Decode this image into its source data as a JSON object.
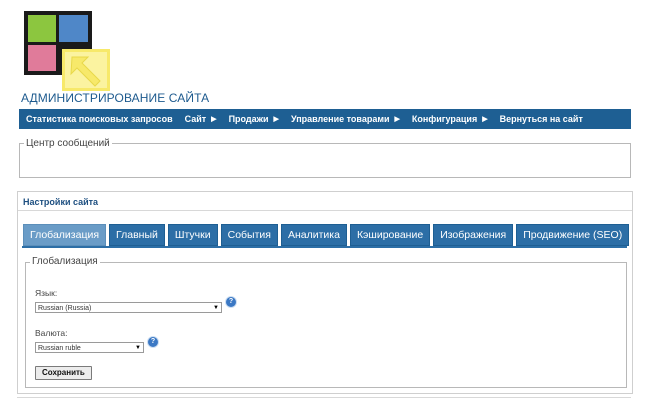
{
  "header": {
    "site_title": "АДМИНИСТРИРОВАНИЕ САЙТА",
    "logo_colors": {
      "green": "#8cc63f",
      "blue": "#4f87c8",
      "pink": "#e07b9a",
      "yellow": "#f7e96a",
      "frame": "#1a1a1a"
    }
  },
  "nav": {
    "items": [
      {
        "label": "Статистика поисковых запросов",
        "arrow": ""
      },
      {
        "label": "Сайт",
        "arrow": "▶"
      },
      {
        "label": "Продажи",
        "arrow": "▶"
      },
      {
        "label": "Управление товарами",
        "arrow": "▶"
      },
      {
        "label": "Конфигурация",
        "arrow": "▶"
      },
      {
        "label": "Вернуться на сайт",
        "arrow": ""
      }
    ]
  },
  "messages": {
    "legend": "Центр сообщений"
  },
  "settings": {
    "title": "Настройки сайта",
    "tabs": [
      {
        "label": "Глобализация"
      },
      {
        "label": "Главный"
      },
      {
        "label": "Штучки"
      },
      {
        "label": "События"
      },
      {
        "label": "Аналитика"
      },
      {
        "label": "Кэширование"
      },
      {
        "label": "Изображения"
      },
      {
        "label": "Продвижение (SEO)"
      }
    ],
    "active_tab": "Глобализация",
    "fieldset_legend": "Глобализация",
    "language_label": "Язык:",
    "language_value": "Russian (Russia)",
    "currency_label": "Валюта:",
    "currency_value": "Russian ruble",
    "help_glyph": "?",
    "save_label": "Сохранить"
  },
  "colors": {
    "nav_bg": "#1e5f93",
    "tab_bg": "#2c6ea6",
    "tab_active": "#6a9cc7",
    "title": "#1d5a8e"
  }
}
